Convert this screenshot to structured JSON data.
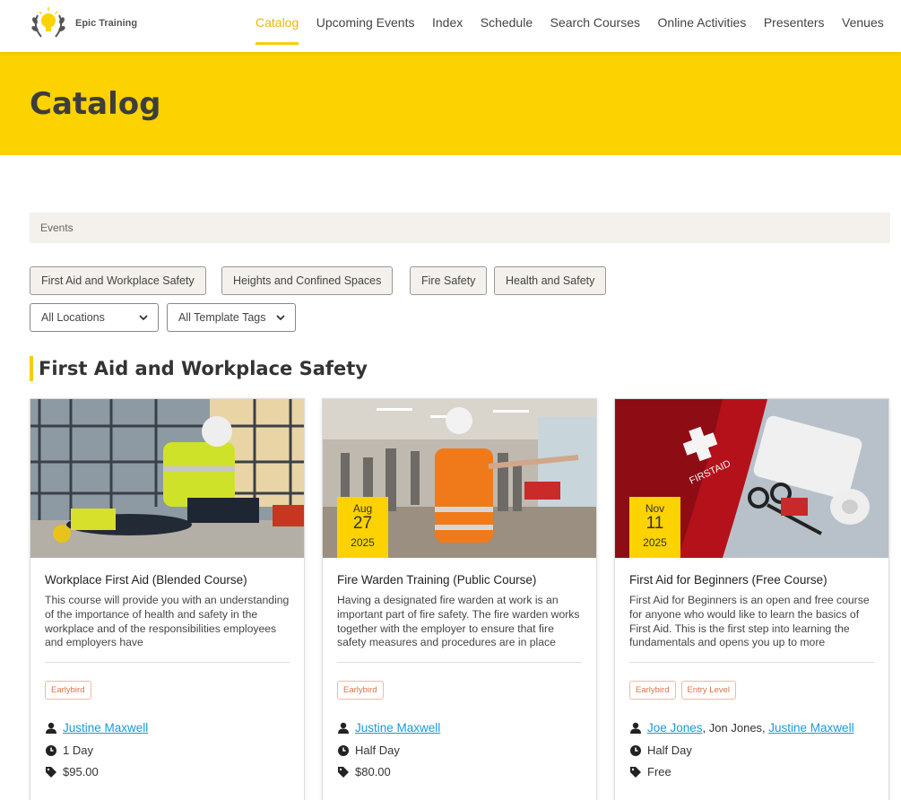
{
  "brand": {
    "name": "Epic Training",
    "accent": "#fcd200"
  },
  "nav": {
    "items": [
      {
        "label": "Catalog",
        "active": true
      },
      {
        "label": "Upcoming Events"
      },
      {
        "label": "Index"
      },
      {
        "label": "Schedule"
      },
      {
        "label": "Search Courses"
      },
      {
        "label": "Online Activities"
      },
      {
        "label": "Presenters"
      },
      {
        "label": "Venues"
      }
    ]
  },
  "hero": {
    "title": "Catalog"
  },
  "events_bar": {
    "label": "Events"
  },
  "categories": [
    "First Aid and Workplace Safety",
    "Heights and Confined Spaces",
    "Fire Safety",
    "Health and Safety"
  ],
  "filters": {
    "location": "All Locations",
    "template_tags": "All Template Tags"
  },
  "section": {
    "title": "First Aid and Workplace Safety"
  },
  "cards": [
    {
      "title": "Workplace First Aid (Blended Course)",
      "description": "This course will provide you with an understanding of the importance of health and safety in the workplace and of the responsibilities employees and employers have",
      "tags": [
        "Earlybird"
      ],
      "presenters_linked": [
        "Justine Maxwell"
      ],
      "duration": "1 Day",
      "price": "$95.00",
      "image": "worker-first-aid-photo"
    },
    {
      "title": "Fire Warden Training (Public Course)",
      "description": "Having a designated fire warden at work is an important part of fire safety. The fire warden works together with the employer to ensure that fire safety measures and procedures are in place",
      "tags": [
        "Earlybird"
      ],
      "presenters_linked": [
        "Justine Maxwell"
      ],
      "duration": "Half Day",
      "price": "$80.00",
      "date": {
        "month": "Aug",
        "day": "27",
        "year": "2025"
      },
      "image": "fire-warden-photo"
    },
    {
      "title": "First Aid for Beginners (Free Course)",
      "description": "First Aid for Beginners is an open and free course for anyone who would like to learn the basics of First Aid. This is the first step into learning the fundamentals and opens you up to more",
      "tags": [
        "Earlybird",
        "Entry Level"
      ],
      "presenters": {
        "first": "Joe Jones",
        "second": "Jon Jones",
        "third": "Justine Maxwell"
      },
      "duration": "Half Day",
      "price": "Free",
      "date": {
        "month": "Nov",
        "day": "11",
        "year": "2025"
      },
      "image": "first-aid-kit-photo"
    }
  ]
}
